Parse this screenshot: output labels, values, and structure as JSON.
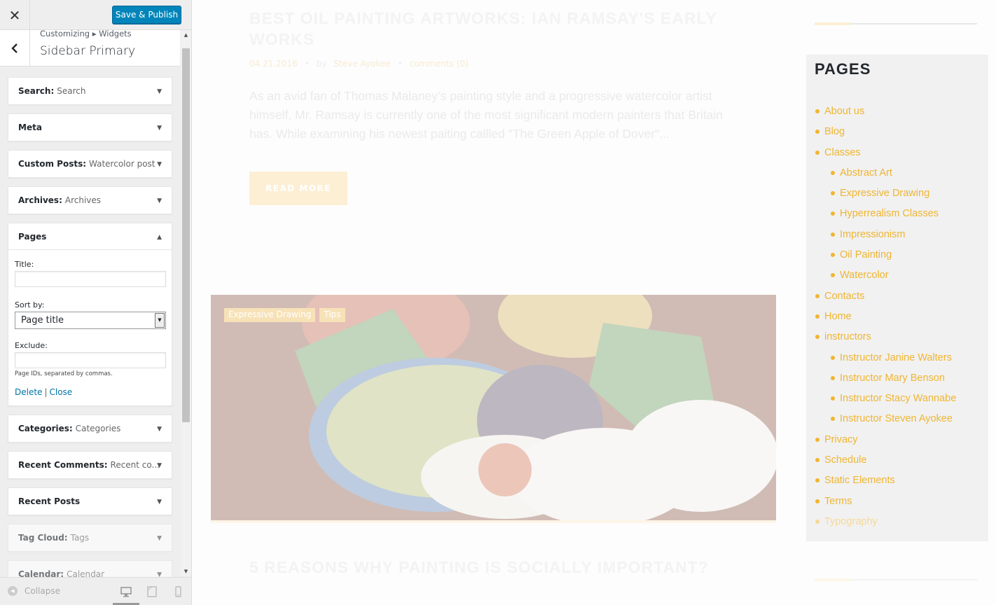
{
  "customizer": {
    "close_icon": "close-icon",
    "publish_label": "Save & Publish",
    "breadcrumb": "Customizing ▸ Widgets",
    "section_name": "Sidebar Primary",
    "widgets": [
      {
        "name": "Search:",
        "sub": "Search"
      },
      {
        "name": "Meta",
        "sub": ""
      },
      {
        "name": "Custom Posts:",
        "sub": "Watercolor post"
      },
      {
        "name": "Archives:",
        "sub": "Archives"
      },
      {
        "name": "Pages",
        "sub": ""
      },
      {
        "name": "Categories:",
        "sub": "Categories"
      },
      {
        "name": "Recent Comments:",
        "sub": "Recent co..."
      },
      {
        "name": "Recent Posts",
        "sub": ""
      },
      {
        "name": "Tag Cloud:",
        "sub": "Tags"
      },
      {
        "name": "Calendar:",
        "sub": "Calendar"
      }
    ],
    "pages_form": {
      "title_label": "Title:",
      "title_value": "",
      "sort_label": "Sort by:",
      "sort_value": "Page title",
      "exclude_label": "Exclude:",
      "exclude_value": "",
      "exclude_hint": "Page IDs, separated by commas.",
      "delete_label": "Delete",
      "separator": "|",
      "close_label": "Close"
    },
    "footer": {
      "collapse_label": "Collapse",
      "active_device": "desktop"
    }
  },
  "preview": {
    "post1": {
      "title": "BEST OIL PAINTING ARTWORKS: IAN RAMSAY'S EARLY WORKS",
      "date": "04.21.2016",
      "by": "by",
      "author": "Steve Ayokee",
      "comments": "comments (0)",
      "excerpt": "As an avid fan of Thomas Malaney’s painting style and a progressive watercolor artist himself, Mr. Ramsay is currently one of the most significant modern painters that Britain has. While examining his newest paiting callled \"The Green Apple of Dover\"...",
      "read_more": "READ MORE"
    },
    "feature_tags": [
      "Expressive Drawing",
      "Tips"
    ],
    "post2": {
      "title": "5 REASONS WHY PAINTING IS SOCIALLY IMPORTANT?"
    },
    "sidebar": {
      "title": "PAGES",
      "accent_color": "#f0b531",
      "pages": [
        {
          "label": "About us",
          "child": false
        },
        {
          "label": "Blog",
          "child": false
        },
        {
          "label": "Classes",
          "child": false
        },
        {
          "label": "Abstract Art",
          "child": true
        },
        {
          "label": "Expressive Drawing",
          "child": true
        },
        {
          "label": "Hyperrealism Classes",
          "child": true
        },
        {
          "label": "Impressionism",
          "child": true
        },
        {
          "label": "Oil Painting",
          "child": true
        },
        {
          "label": "Watercolor",
          "child": true
        },
        {
          "label": "Contacts",
          "child": false
        },
        {
          "label": "Home",
          "child": false
        },
        {
          "label": "instructors",
          "child": false
        },
        {
          "label": "Instructor Janine Walters",
          "child": true
        },
        {
          "label": "Instructor Mary Benson",
          "child": true
        },
        {
          "label": "Instructor Stacy Wannabe",
          "child": true
        },
        {
          "label": "Instructor Steven Ayokee",
          "child": true
        },
        {
          "label": "Privacy",
          "child": false
        },
        {
          "label": "Schedule",
          "child": false
        },
        {
          "label": "Static Elements",
          "child": false
        },
        {
          "label": "Terms",
          "child": false
        },
        {
          "label": "Typography",
          "child": false
        }
      ]
    }
  }
}
